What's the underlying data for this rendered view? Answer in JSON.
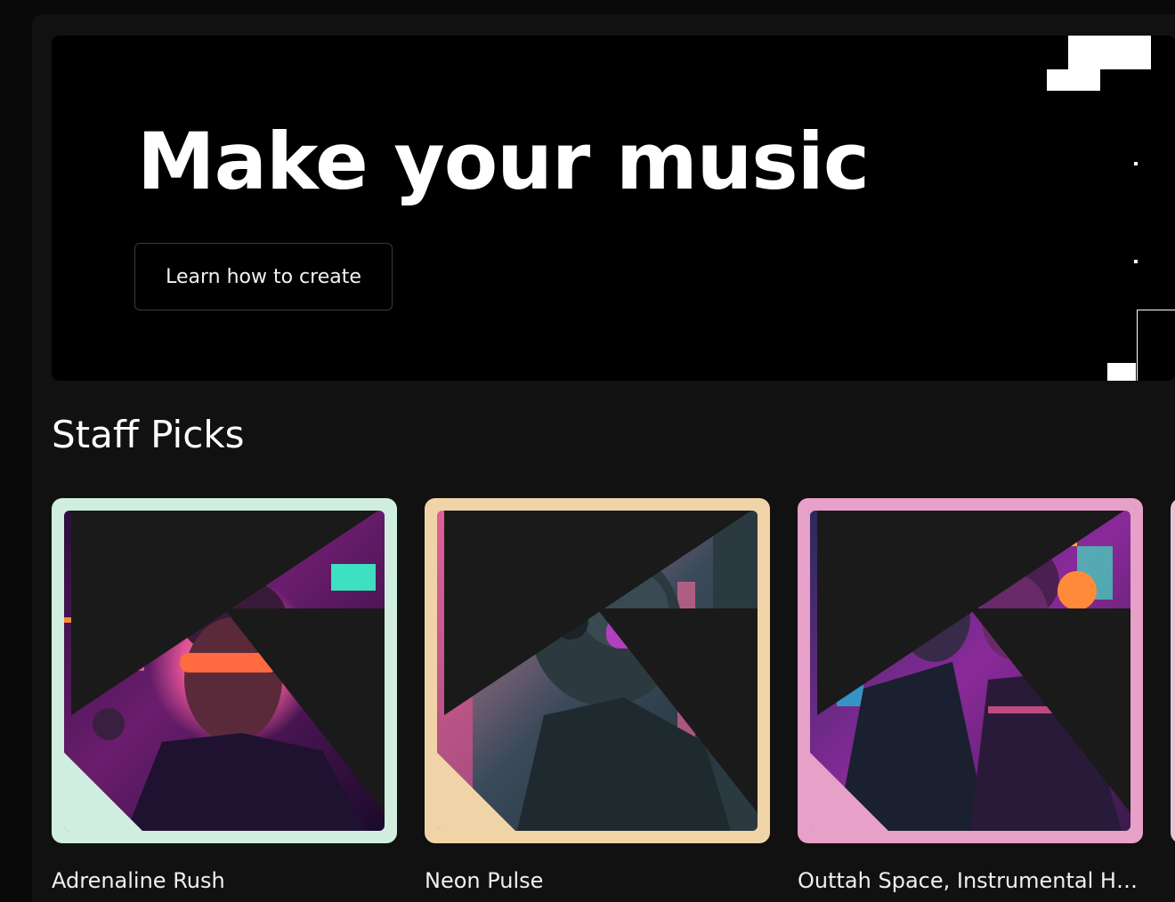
{
  "hero": {
    "title": "Make your music",
    "cta_label": "Learn how to create"
  },
  "staff_picks": {
    "title": "Staff Picks",
    "items": [
      {
        "title": "Adrenaline Rush",
        "frame_color": "#cfeee0",
        "art": "neon-club-portrait-with-sunglasses"
      },
      {
        "title": "Neon Pulse",
        "frame_color": "#f0d4a8",
        "art": "cyber-alien-with-headphones"
      },
      {
        "title": "Outtah Space, Instrumental Hip...",
        "frame_color": "#e7a0c8",
        "art": "neon-couple-embrace"
      }
    ]
  },
  "colors": {
    "background": "#090909",
    "panel": "#111111",
    "hero": "#000000"
  }
}
